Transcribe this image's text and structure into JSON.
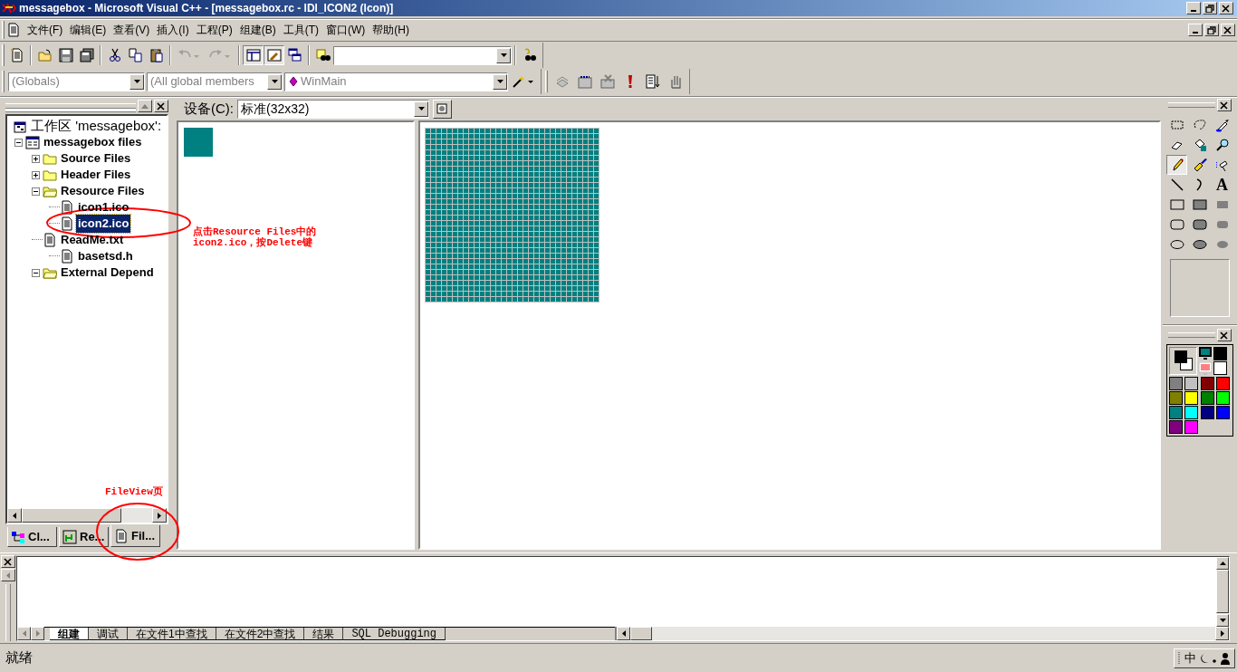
{
  "title_bar": {
    "title": "messagebox - Microsoft Visual C++ - [messagebox.rc - IDI_ICON2 (Icon)]"
  },
  "menu_bar": [
    "文件(F)",
    "编辑(E)",
    "查看(V)",
    "插入(I)",
    "工程(P)",
    "组建(B)",
    "工具(T)",
    "窗口(W)",
    "帮助(H)"
  ],
  "toolbar": [
    {
      "kind": "new",
      "pressed": false,
      "disabled": false
    },
    {
      "kind": "open",
      "pressed": false,
      "disabled": false
    },
    {
      "kind": "save",
      "pressed": false,
      "disabled": false
    },
    {
      "kind": "saveall",
      "pressed": false,
      "disabled": false
    },
    {
      "kind": "cut",
      "pressed": false,
      "disabled": false
    },
    {
      "kind": "copy",
      "pressed": false,
      "disabled": false
    },
    {
      "kind": "paste",
      "pressed": false,
      "disabled": false
    },
    {
      "kind": "undo",
      "pressed": false,
      "disabled": true
    },
    {
      "kind": "redo",
      "pressed": false,
      "disabled": true
    },
    {
      "kind": "workspace",
      "pressed": true,
      "disabled": false
    },
    {
      "kind": "output",
      "pressed": true,
      "disabled": false
    },
    {
      "kind": "windows",
      "pressed": false,
      "disabled": false
    },
    {
      "kind": "find",
      "pressed": false,
      "disabled": false
    },
    {
      "kind": "combo"
    },
    {
      "kind": "help",
      "pressed": false,
      "disabled": false
    }
  ],
  "wizard_bar": {
    "class_combo": "(Globals)",
    "filter_combo": "(All global members",
    "member_combo": "WinMain"
  },
  "workspace": {
    "tree": [
      {
        "label": "工作区 'messagebox':",
        "kind": "workspace",
        "selected": false,
        "children": [
          {
            "label": "messagebox files",
            "kind": "project",
            "expanded": true,
            "selected": false,
            "children": [
              {
                "label": "Source Files",
                "kind": "folder",
                "expanded": false,
                "selected": false
              },
              {
                "label": "Header Files",
                "kind": "folder",
                "expanded": false,
                "selected": false
              },
              {
                "label": "Resource Files",
                "kind": "folder",
                "expanded": true,
                "selected": false,
                "children": [
                  {
                    "label": "icon1.ico",
                    "kind": "file",
                    "selected": false
                  },
                  {
                    "label": "icon2.ico",
                    "kind": "file",
                    "selected": true
                  }
                ]
              },
              {
                "label": "ReadMe.txt",
                "kind": "file",
                "selected": false,
                "children": [
                  {
                    "label": "basetsd.h",
                    "kind": "file",
                    "selected": false
                  }
                ]
              },
              {
                "label": "External Depend",
                "kind": "folder",
                "expanded": true,
                "selected": false
              }
            ]
          }
        ]
      }
    ],
    "tabs": [
      {
        "label": "Cl...",
        "kind": "class",
        "selected": false
      },
      {
        "label": "Re...",
        "kind": "resource",
        "selected": false
      },
      {
        "label": "Fil...",
        "kind": "file",
        "selected": true
      }
    ]
  },
  "annotations": [
    {
      "text": "点击Resource Files中的icon2.ico，按Delete键"
    },
    {
      "text": "FileView页"
    }
  ],
  "editor": {
    "device_label": "设备(C):",
    "device_value": "标准(32x32)"
  },
  "tools": [
    {
      "kind": "rect-select",
      "selected": false
    },
    {
      "kind": "lasso",
      "selected": false
    },
    {
      "kind": "eyedropper",
      "selected": false
    },
    {
      "kind": "eraser",
      "selected": false
    },
    {
      "kind": "fill",
      "selected": false
    },
    {
      "kind": "magnifier",
      "selected": false
    },
    {
      "kind": "pencil",
      "selected": true
    },
    {
      "kind": "brush",
      "selected": false
    },
    {
      "kind": "airbrush",
      "selected": false
    },
    {
      "kind": "line",
      "selected": false
    },
    {
      "kind": "curve",
      "selected": false
    },
    {
      "kind": "text",
      "glyph": "A",
      "selected": false
    },
    {
      "kind": "rect-outline",
      "selected": false
    },
    {
      "kind": "rect-both",
      "selected": false
    },
    {
      "kind": "rect-fill",
      "selected": false
    },
    {
      "kind": "round-outline",
      "selected": false
    },
    {
      "kind": "round-both",
      "selected": false
    },
    {
      "kind": "round-fill",
      "selected": false
    },
    {
      "kind": "ellipse-outline",
      "selected": false
    },
    {
      "kind": "ellipse-both",
      "selected": false
    },
    {
      "kind": "ellipse-fill",
      "selected": false
    }
  ],
  "colors": [
    {
      "color": "#000000"
    },
    {
      "color": "#ffffff"
    },
    {
      "color": "#808080"
    },
    {
      "color": "#c0c0c0"
    },
    {
      "color": "#800000"
    },
    {
      "color": "#ff0000"
    },
    {
      "color": "#808000"
    },
    {
      "color": "#ffff00"
    },
    {
      "color": "#008000"
    },
    {
      "color": "#00ff00"
    },
    {
      "color": "#008080"
    },
    {
      "color": "#00ffff"
    },
    {
      "color": "#000080"
    },
    {
      "color": "#0000ff"
    },
    {
      "color": "#800080"
    },
    {
      "color": "#ff00ff"
    }
  ],
  "output": {
    "tabs": [
      {
        "label": "组建",
        "selected": true
      },
      {
        "label": "调试",
        "selected": false
      },
      {
        "label": "在文件1中查找",
        "selected": false
      },
      {
        "label": "在文件2中查找",
        "selected": false
      },
      {
        "label": "结果",
        "selected": false
      },
      {
        "label": "SQL Debugging",
        "selected": false
      }
    ]
  },
  "status_bar": {
    "text": "就绪",
    "ime": "中"
  }
}
